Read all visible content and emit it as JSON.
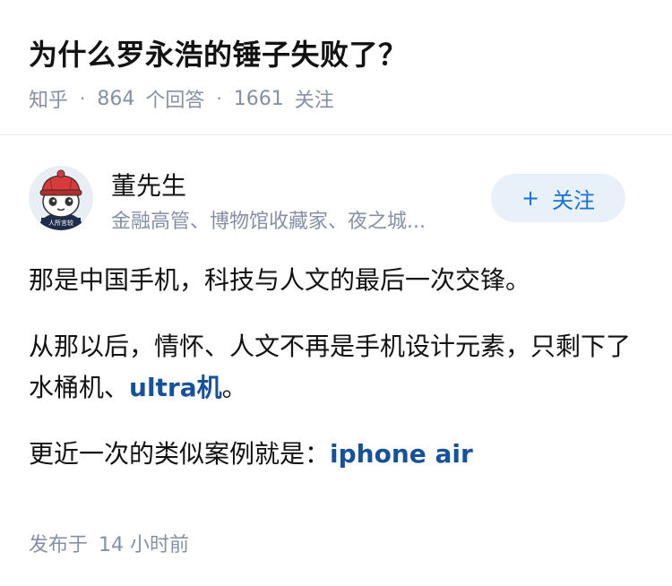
{
  "question": {
    "title": "为什么罗永浩的锤子失败了？",
    "source": "知乎",
    "separator": "·",
    "answer_count": "864",
    "answer_label": "个回答",
    "follower_count": "1661",
    "follower_label": "关注"
  },
  "author": {
    "name": "董先生",
    "bio": "金融高管、博物馆收藏家、夜之城...",
    "avatar_icon": "cartoon-hat-avatar",
    "avatar_caption": "人所言较",
    "follow_icon": "plus-icon",
    "follow_symbol": "+",
    "follow_label": "关注"
  },
  "answer": {
    "paragraph_1": "那是中国手机，科技与人文的最后一次交锋。",
    "paragraph_2_text": "从那以后，情怀、人文不再是手机设计元素，只剩下了水桶机、",
    "paragraph_2_link": "ultra机",
    "paragraph_2_end": "。",
    "paragraph_3_text": "更近一次的类似案例就是：",
    "paragraph_3_link": "iphone air"
  },
  "footer": {
    "published_label": "发布于",
    "published_time": "14 小时前"
  },
  "colors": {
    "link": "#175199",
    "follow_text": "#1772d0",
    "follow_bg": "#e8f0fa",
    "meta": "#8590a6"
  }
}
